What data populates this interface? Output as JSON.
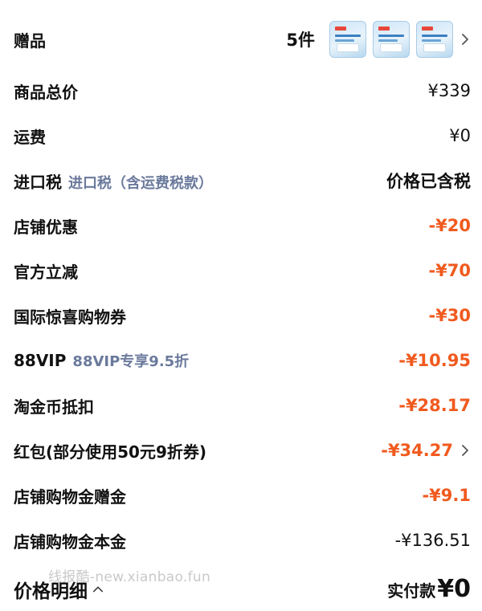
{
  "gift_row": {
    "label": "赠品",
    "count": "5件"
  },
  "rows": [
    {
      "label": "商品总价",
      "sublabel": "",
      "value": "¥339"
    },
    {
      "label": "运费",
      "sublabel": "",
      "value": "¥0"
    },
    {
      "label": "进口税",
      "sublabel": "进口税（含运费税款）",
      "value": "价格已含税"
    },
    {
      "label": "店铺优惠",
      "sublabel": "",
      "value": "-¥20"
    },
    {
      "label": "官方立减",
      "sublabel": "",
      "value": "-¥70"
    },
    {
      "label": "国际惊喜购物券",
      "sublabel": "",
      "value": "-¥30"
    },
    {
      "label": "88VIP",
      "sublabel": "88VIP专享9.5折",
      "value": "-¥10.95"
    },
    {
      "label": "淘金币抵扣",
      "sublabel": "",
      "value": "-¥28.17"
    },
    {
      "label": "红包(部分使用50元9折券)",
      "sublabel": "",
      "value": "-¥34.27"
    },
    {
      "label": "店铺购物金赠金",
      "sublabel": "",
      "value": "-¥9.1"
    },
    {
      "label": "店铺购物金本金",
      "sublabel": "",
      "value": "-¥136.51"
    }
  ],
  "footer": {
    "title": "价格明细",
    "pay_label": "实付款",
    "pay_value": "¥0"
  },
  "watermark": "线报酷-new.xianbao.fun",
  "colors": {
    "discount": "#f05a1e",
    "sublabel": "#6b7a9c",
    "text": "#111111"
  },
  "icons": {
    "gift_chevron": "chevron-right-icon",
    "redpacket_chevron": "chevron-right-icon",
    "detail_toggle": "chevron-up-icon"
  }
}
